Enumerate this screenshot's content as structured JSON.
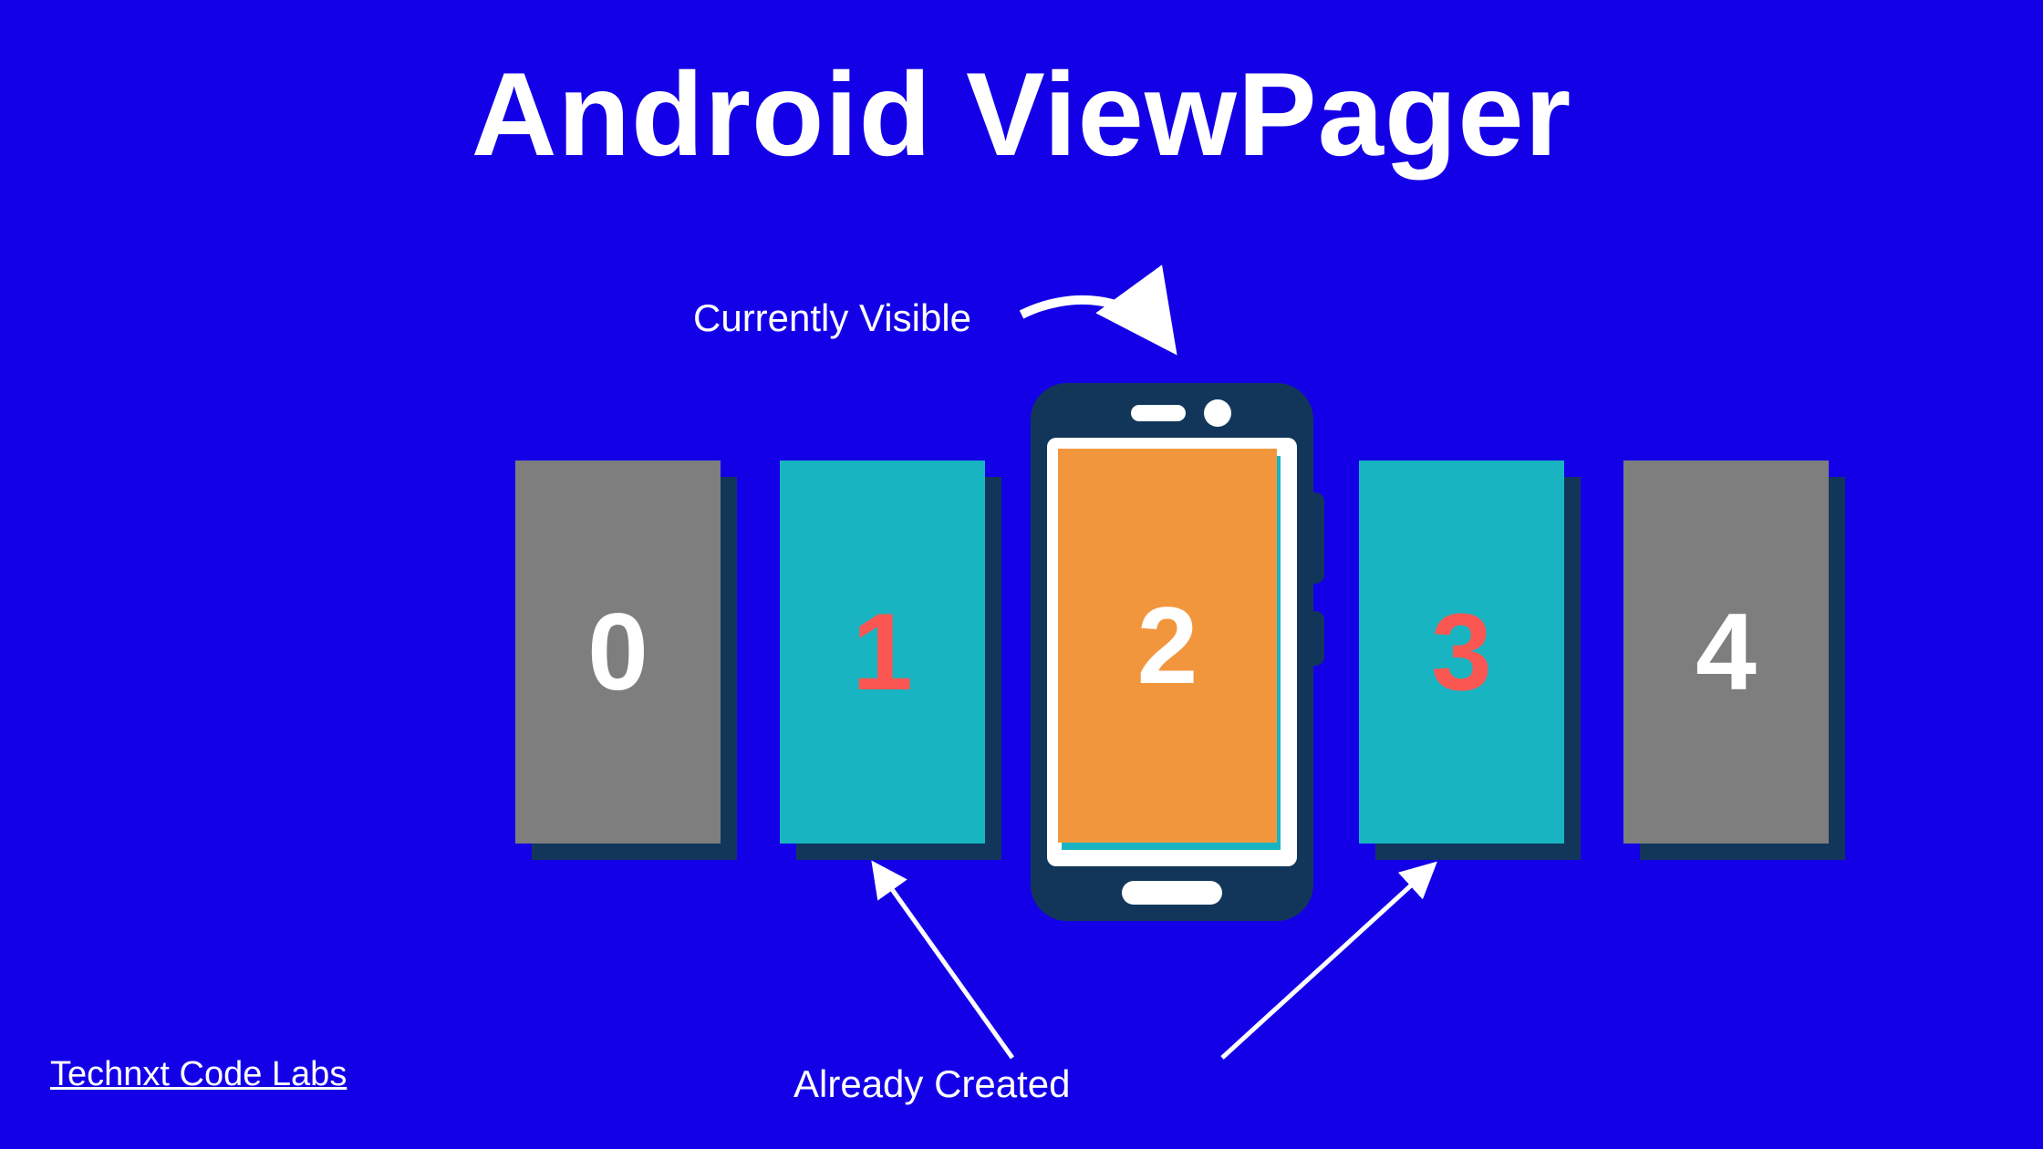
{
  "title": "Android ViewPager",
  "labels": {
    "currently_visible": "Currently Visible",
    "already_created": "Already Created"
  },
  "credit": "Technxt Code Labs",
  "cards": {
    "c0": "0",
    "c1": "1",
    "c2": "2",
    "c3": "3",
    "c4": "4"
  },
  "colors": {
    "background": "#1400E6",
    "card_gray": "#7E7E7E",
    "card_teal": "#19B4C2",
    "card_shadow": "#12365A",
    "phone_body": "#12365A",
    "phone_screen": "#F2963E",
    "accent_text": "#FA5752",
    "text": "#FFFFFF"
  }
}
